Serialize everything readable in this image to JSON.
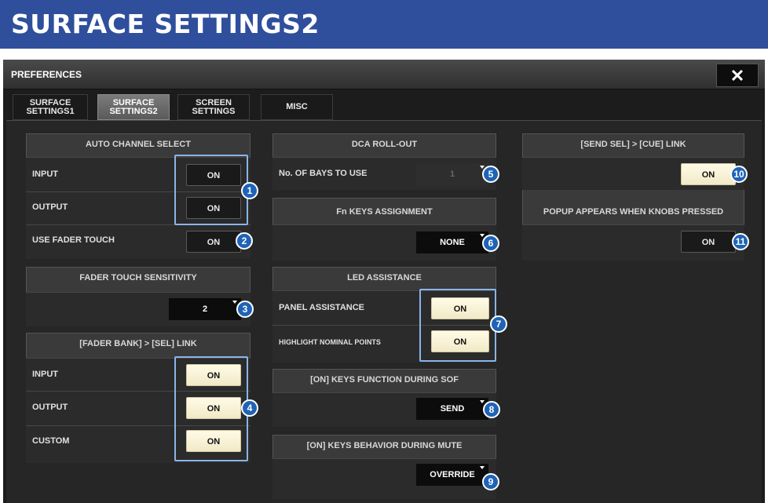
{
  "banner": {
    "title": "SURFACE SETTINGS2"
  },
  "window": {
    "title": "PREFERENCES",
    "close": "✕"
  },
  "tabs": [
    {
      "label": "SURFACE\nSETTINGS1"
    },
    {
      "label": "SURFACE\nSETTINGS2"
    },
    {
      "label": "SCREEN\nSETTINGS"
    },
    {
      "label": "MISC"
    }
  ],
  "auto_channel_select": {
    "header": "AUTO CHANNEL SELECT",
    "input_label": "INPUT",
    "input_value": "ON",
    "output_label": "OUTPUT",
    "output_value": "ON",
    "fader_touch_label": "USE FADER TOUCH",
    "fader_touch_value": "ON"
  },
  "fader_touch_sensitivity": {
    "header": "FADER TOUCH SENSITIVITY",
    "value": "2"
  },
  "fader_bank_sel_link": {
    "header": "[FADER BANK] > [SEL] LINK",
    "input_label": "INPUT",
    "input_value": "ON",
    "output_label": "OUTPUT",
    "output_value": "ON",
    "custom_label": "CUSTOM",
    "custom_value": "ON"
  },
  "dca_rollout": {
    "header": "DCA ROLL-OUT",
    "bays_label": "No. OF BAYS TO USE",
    "bays_value": "1"
  },
  "fn_keys": {
    "header": "Fn KEYS ASSIGNMENT",
    "value": "NONE"
  },
  "led_assistance": {
    "header": "LED ASSISTANCE",
    "panel_label": "PANEL ASSISTANCE",
    "panel_value": "ON",
    "highlight_label": "HIGHLIGHT NOMINAL POINTS",
    "highlight_value": "ON"
  },
  "on_keys_sof": {
    "header": "[ON] KEYS FUNCTION DURING SOF",
    "value": "SEND"
  },
  "on_keys_mute": {
    "header": "[ON] KEYS BEHAVIOR DURING MUTE",
    "value": "OVERRIDE"
  },
  "send_sel_cue": {
    "header": "[SEND SEL] > [CUE] LINK",
    "value": "ON"
  },
  "popup_knobs": {
    "header": "POPUP APPEARS WHEN KNOBS PRESSED",
    "value": "ON"
  },
  "callouts": [
    "1",
    "2",
    "3",
    "4",
    "5",
    "6",
    "7",
    "8",
    "9",
    "10",
    "11"
  ],
  "colors": {
    "banner": "#2f4f9c",
    "callout": "#1f63b6",
    "group_outline": "#8ab4e8",
    "on_lit": "#fffbe6"
  }
}
